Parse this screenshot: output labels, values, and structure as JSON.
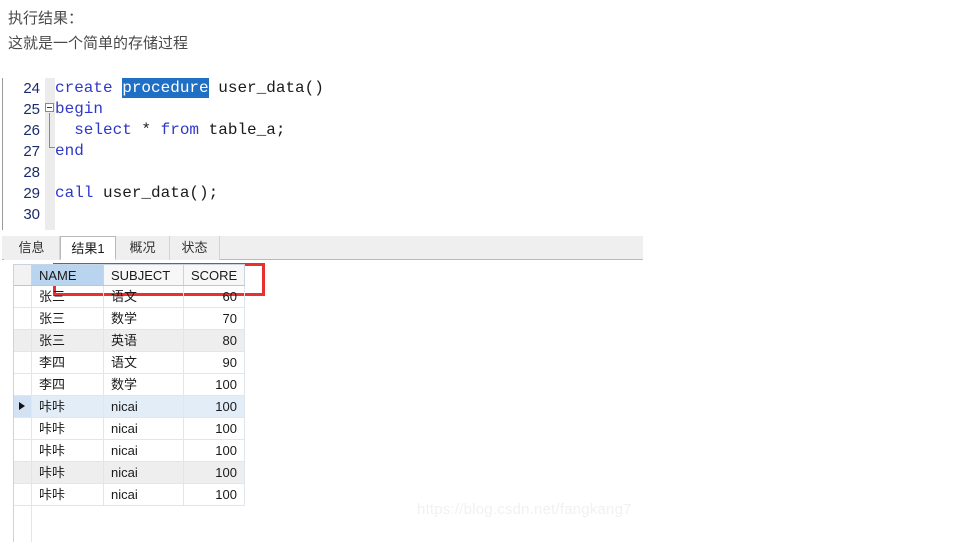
{
  "intro": {
    "line1": "执行结果：",
    "line2": "这就是一个简单的存储过程"
  },
  "editor": {
    "lines": [
      {
        "number": "24",
        "segments": [
          {
            "text": "create ",
            "style": "kw"
          },
          {
            "text": "procedure",
            "style": "selected"
          },
          {
            "text": " user_data()",
            "style": "plain"
          }
        ]
      },
      {
        "number": "25",
        "segments": [
          {
            "text": "begin",
            "style": "kw"
          }
        ]
      },
      {
        "number": "26",
        "segments": [
          {
            "text": "  select ",
            "style": "kw"
          },
          {
            "text": "* ",
            "style": "plain"
          },
          {
            "text": "from ",
            "style": "kw"
          },
          {
            "text": "table_a;",
            "style": "plain"
          }
        ]
      },
      {
        "number": "27",
        "segments": [
          {
            "text": "end",
            "style": "kw"
          }
        ]
      },
      {
        "number": "28",
        "segments": []
      },
      {
        "number": "29",
        "segments": [
          {
            "text": "call ",
            "style": "kw"
          },
          {
            "text": "user_data();",
            "style": "plain"
          }
        ]
      },
      {
        "number": "30",
        "segments": []
      }
    ],
    "keyword_color": "#2f39c9",
    "selection_color": "#1f6fc4",
    "highlight_box_color": "#e8302f",
    "linenumber_color": "#1b2c6b"
  },
  "tabs": [
    {
      "label": "信息",
      "active": false
    },
    {
      "label": "结果1",
      "active": true
    },
    {
      "label": "概况",
      "active": false
    },
    {
      "label": "状态",
      "active": false
    }
  ],
  "grid": {
    "columns": [
      "NAME",
      "SUBJECT",
      "SCORE"
    ],
    "selected_column": "NAME",
    "selected_column_color": "#b9d4ee",
    "current_row_index": 5,
    "rows": [
      {
        "name": "张三",
        "subject": "语文",
        "score": "60"
      },
      {
        "name": "张三",
        "subject": "数学",
        "score": "70"
      },
      {
        "name": "张三",
        "subject": "英语",
        "score": "80"
      },
      {
        "name": "李四",
        "subject": "语文",
        "score": "90"
      },
      {
        "name": "李四",
        "subject": "数学",
        "score": "100"
      },
      {
        "name": "咔咔",
        "subject": "nicai",
        "score": "100"
      },
      {
        "name": "咔咔",
        "subject": "nicai",
        "score": "100"
      },
      {
        "name": "咔咔",
        "subject": "nicai",
        "score": "100"
      },
      {
        "name": "咔咔",
        "subject": "nicai",
        "score": "100"
      },
      {
        "name": "咔咔",
        "subject": "nicai",
        "score": "100"
      }
    ]
  },
  "watermark": {
    "text": "https://blog.csdn.net/fangkang7"
  }
}
